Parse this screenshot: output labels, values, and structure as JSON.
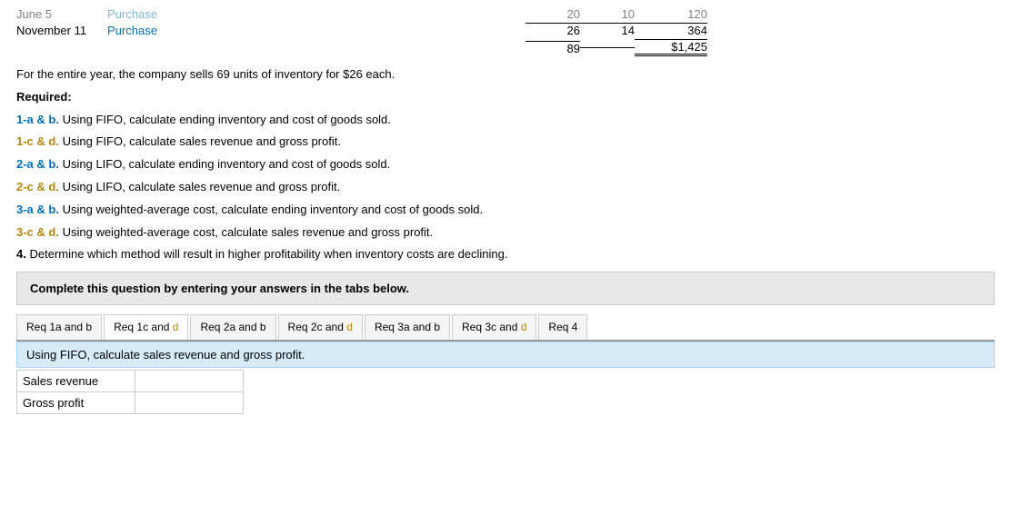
{
  "top_table": {
    "rows": [
      {
        "col1": "June 5",
        "col2": "Purchase",
        "col3": "",
        "col4": "20",
        "col5": "10",
        "col6": "120",
        "border_top": false,
        "double_border": false,
        "faded": true
      },
      {
        "col1": "November 11",
        "col2": "Purchase",
        "col3": "",
        "col4": "26",
        "col5": "14",
        "col6": "364",
        "border_top": true,
        "double_border": false,
        "faded": false
      },
      {
        "col1": "",
        "col2": "",
        "col3": "",
        "col4": "89",
        "col5": "",
        "col6": "$1,425",
        "border_top": true,
        "double_border": true,
        "faded": false
      }
    ]
  },
  "intro": {
    "line1": "For the entire year, the company sells 69 units of inventory for $26 each.",
    "required_label": "Required:",
    "items": [
      {
        "prefix": "1-a & b.",
        "prefix_style": "bold_blue",
        "text": " Using FIFO, calculate ending inventory and cost of goods sold."
      },
      {
        "prefix": "1-c & d.",
        "prefix_style": "bold_gold",
        "text": " Using FIFO, calculate sales revenue and gross profit."
      },
      {
        "prefix": "2-a & b.",
        "prefix_style": "bold_blue",
        "text": " Using LIFO, calculate ending inventory and cost of goods sold."
      },
      {
        "prefix": "2-c & d.",
        "prefix_style": "bold_gold",
        "text": " Using LIFO, calculate sales revenue and gross profit."
      },
      {
        "prefix": "3-a & b.",
        "prefix_style": "bold_blue",
        "text": " Using weighted-average cost, calculate ending inventory and cost of goods sold."
      },
      {
        "prefix": "3-c & d.",
        "prefix_style": "bold_gold",
        "text": " Using weighted-average cost, calculate sales revenue and gross profit."
      },
      {
        "prefix": "4.",
        "prefix_style": "bold",
        "text": " Determine which method will result in higher profitability when inventory costs are declining."
      }
    ]
  },
  "complete_box": {
    "text": "Complete this question by entering your answers in the tabs below."
  },
  "tabs": [
    {
      "id": "req1ab",
      "label_black": "Req 1a and b",
      "label_colored": "",
      "active": false
    },
    {
      "id": "req1cd",
      "label_black": "Req 1c and ",
      "label_colored": "d",
      "color": "gold",
      "active": true
    },
    {
      "id": "req2ab",
      "label_black": "Req 2a and b",
      "label_colored": "",
      "active": false
    },
    {
      "id": "req2cd",
      "label_black": "Req 2c and ",
      "label_colored": "d",
      "color": "gold",
      "active": false
    },
    {
      "id": "req3ab",
      "label_black": "Req 3a and b",
      "label_colored": "",
      "active": false
    },
    {
      "id": "req3cd",
      "label_black": "Req 3c and ",
      "label_colored": "d",
      "color": "gold",
      "active": false
    },
    {
      "id": "req4",
      "label_black": "Req 4",
      "label_colored": "",
      "active": false
    }
  ],
  "active_tab_header": "Using FIFO, calculate sales revenue and gross profit.",
  "input_rows": [
    {
      "label": "Sales revenue",
      "value": ""
    },
    {
      "label": "Gross profit",
      "value": ""
    }
  ]
}
